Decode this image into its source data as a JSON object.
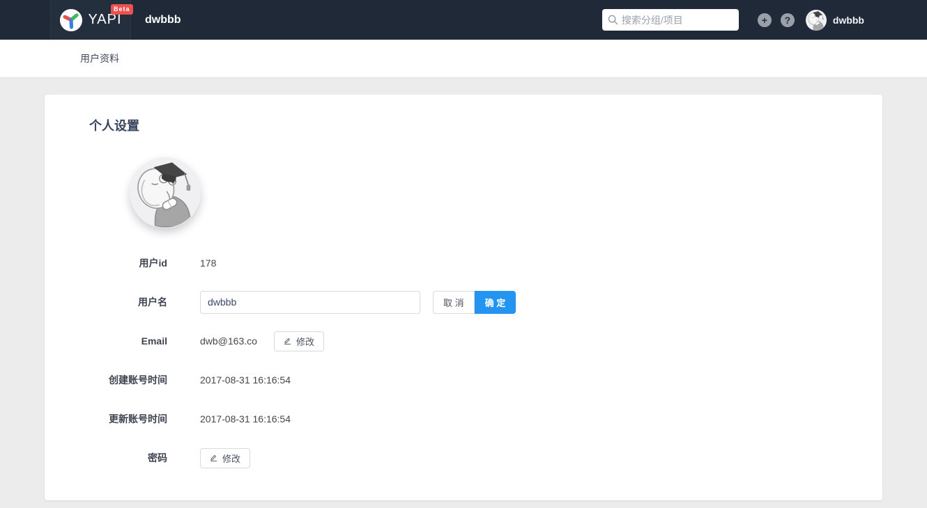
{
  "navbar": {
    "brand": "YAPI",
    "beta_badge": "Beta",
    "page_title": "dwbbb",
    "search_placeholder": "搜索分组/项目",
    "username": "dwbbb",
    "icons": {
      "add": "+",
      "help": "?"
    }
  },
  "subnav": {
    "items": [
      {
        "label": "用户资料"
      }
    ]
  },
  "profile": {
    "heading": "个人设置",
    "user_id": {
      "label": "用户id",
      "value": "178"
    },
    "username": {
      "label": "用户名",
      "value": "dwbbb",
      "cancel_label": "取 消",
      "confirm_label": "确 定"
    },
    "email": {
      "label": "Email",
      "value": "dwb@163.co",
      "edit_label": "修改"
    },
    "created": {
      "label": "创建账号时间",
      "value": "2017-08-31 16:16:54"
    },
    "updated": {
      "label": "更新账号时间",
      "value": "2017-08-31 16:16:54"
    },
    "password": {
      "label": "密码",
      "edit_label": "修改"
    }
  },
  "colors": {
    "navbar_bg": "#202938",
    "primary_blue": "#2395f1",
    "beta_red": "#ee5050",
    "page_bg": "#ececec"
  }
}
